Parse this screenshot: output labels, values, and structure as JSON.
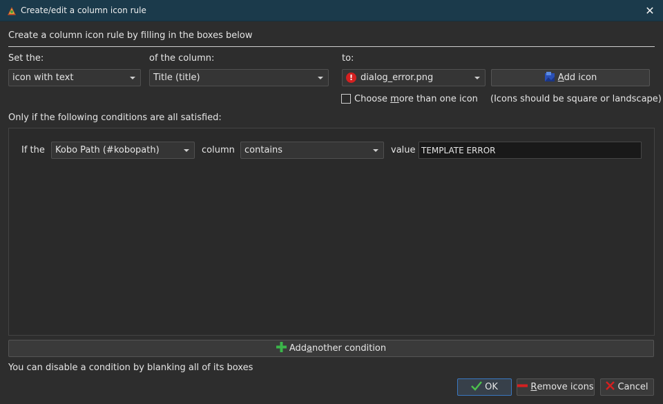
{
  "window": {
    "title": "Create/edit a column icon rule",
    "close_glyph": "✕"
  },
  "intro": "Create a column icon rule by filling in the boxes below",
  "set_the": {
    "label": "Set the:",
    "value": "icon with text"
  },
  "of_the_column": {
    "label": "of the column:",
    "value": "Title (title)"
  },
  "to": {
    "label": "to:",
    "icon": "error-icon",
    "value": "dialog_error.png"
  },
  "add_icon": {
    "pre": "",
    "accel": "A",
    "post": "dd icon"
  },
  "choose_more": {
    "pre": "Choose ",
    "accel": "m",
    "post": "ore than one icon",
    "checked": false
  },
  "icons_hint": "(Icons should be square or landscape)",
  "conditions_heading": "Only if the following conditions are all satisfied:",
  "condition": {
    "if_the_label": "If the",
    "column_value": "Kobo Path (#kobopath)",
    "column_label": "column",
    "operator_value": "contains",
    "value_label": "value",
    "value_text": "TEMPLATE ERROR"
  },
  "add_condition": {
    "pre": "Add ",
    "accel": "a",
    "post": "nother condition"
  },
  "disable_hint": "You can disable a condition by blanking all of its boxes",
  "buttons": {
    "ok": "OK",
    "remove": {
      "accel": "R",
      "post": "emove icons"
    },
    "cancel": "Cancel"
  },
  "colors": {
    "titlebar": "#1b3a4b",
    "accent": "#3a78c2",
    "error_red": "#d42020",
    "add_green": "#3bb54a"
  }
}
